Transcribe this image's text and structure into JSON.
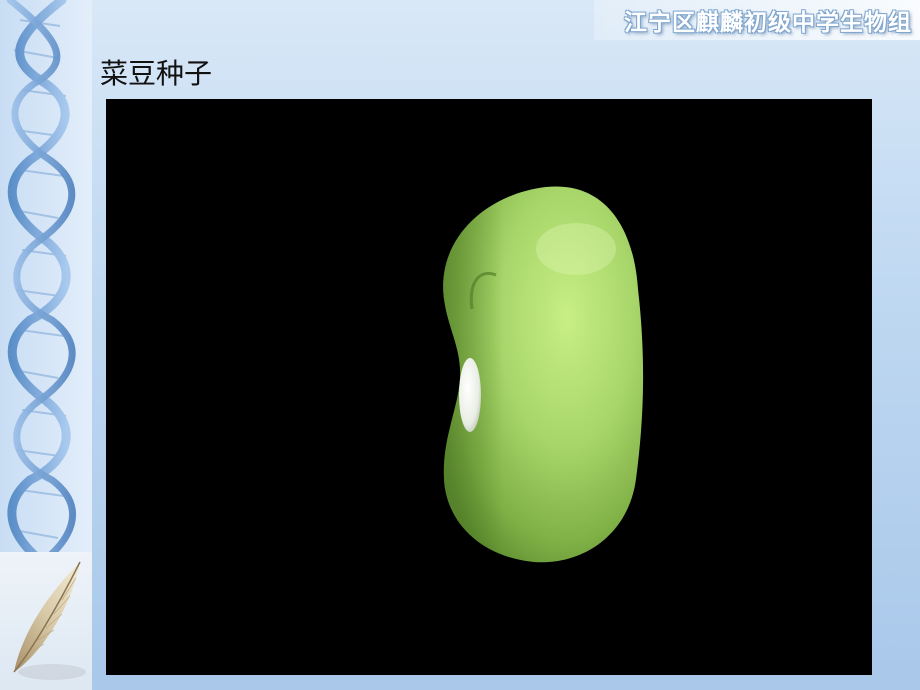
{
  "header": {
    "banner_text": "江宁区麒麟初级中学生物组"
  },
  "slide": {
    "title": "菜豆种子"
  },
  "decorations": {
    "left_art": [
      "dna-helix-icon",
      "feather-icon"
    ],
    "accent_color": "#8fb7e3",
    "background_color": "#c5dcf3"
  },
  "media": {
    "description_icon": "bean-seed-image",
    "seed_color": "#a8d66a",
    "background": "#000000"
  }
}
